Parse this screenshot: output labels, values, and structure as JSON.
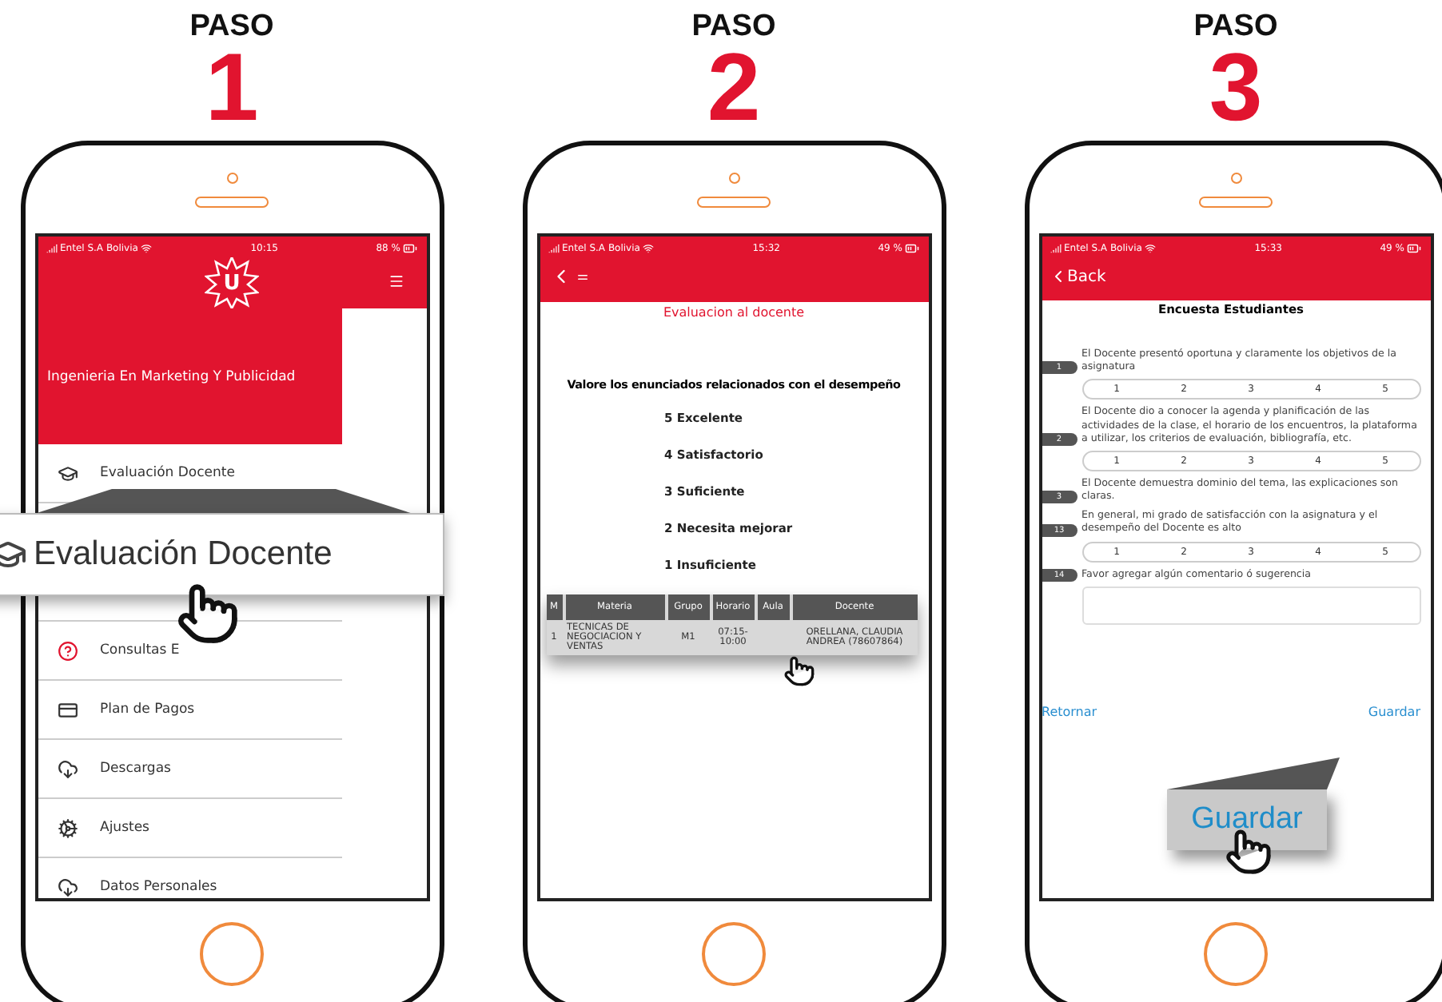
{
  "steps": [
    {
      "label": "PASO",
      "number": "1",
      "screen": {
        "kind": "menu",
        "status": {
          "carrier": "Entel S.A Bolivia",
          "time": "10:15",
          "battery": "88 %"
        },
        "logo_letter": "U",
        "header_title": "Ingenieria En Marketing Y Publicidad",
        "menu_items": [
          {
            "label": "Evaluación Docente",
            "kind": "cap"
          },
          {
            "kind": "hidden"
          },
          {
            "label": "Consultas E",
            "kind": "question"
          },
          {
            "label": "Plan de Pagos",
            "kind": "card"
          },
          {
            "label": "Descargas",
            "kind": "cloud"
          },
          {
            "label": "Ajustes",
            "kind": "gears"
          },
          {
            "label": "Datos Personales",
            "kind": "cloud"
          }
        ],
        "callout": "Evaluación Docente"
      }
    },
    {
      "label": "PASO",
      "number": "2",
      "screen": {
        "kind": "table",
        "status": {
          "carrier": "Entel S.A Bolivia",
          "time": "15:32",
          "battery": "49 %"
        },
        "title": "Evaluacion al docente",
        "prompt": "Valore los enunciados relacionados con el desempeño",
        "scale": [
          "5 Excelente",
          "4 Satisfactorio",
          "3 Suficiente",
          "2 Necesita mejorar",
          "1 Insuficiente"
        ],
        "columns": [
          "M",
          "Materia",
          "Grupo",
          "Horario",
          "Aula",
          "Docente"
        ],
        "rows": [
          {
            "m": "1",
            "materia": "TECNICAS DE NEGOCIACION Y VENTAS",
            "grupo": "M1",
            "horario": "07:15-10:00",
            "docente": "ORELLANA, CLAUDIA ANDREA (78607864)"
          }
        ]
      }
    },
    {
      "label": "PASO",
      "number": "3",
      "screen": {
        "kind": "survey",
        "status": {
          "carrier": "Entel S.A Bolivia",
          "time": "15:33",
          "battery": "49 %"
        },
        "back": "Back",
        "title": "Encuesta Estudiantes",
        "questions": [
          {
            "number": "1",
            "text": "El Docente presentó oportuna y claramente los objetivos de la asignatura",
            "options": [
              "1",
              "2",
              "3",
              "4",
              "5"
            ]
          },
          {
            "number": "2",
            "text": "El Docente dio a conocer la agenda y planificación de las actividades de la clase, el horario de los encuentros, la plataforma a utilizar, los criterios de evaluación, bibliografía, etc.",
            "options": [
              "1",
              "2",
              "3",
              "4",
              "5"
            ]
          },
          {
            "number": "3",
            "text": "El Docente demuestra dominio del tema, las explicaciones son claras."
          },
          {
            "number": "13",
            "text": "En general, mi grado de satisfacción con la asignatura y el desempeño del Docente es alto",
            "options": [
              "1",
              "2",
              "3",
              "4",
              "5"
            ]
          },
          {
            "number": "14",
            "text": "Favor agregar algún comentario ó sugerencia",
            "kind": "comment"
          }
        ],
        "back_link": "Retornar",
        "save_link": "Guardar",
        "callout": "Guardar"
      }
    }
  ]
}
